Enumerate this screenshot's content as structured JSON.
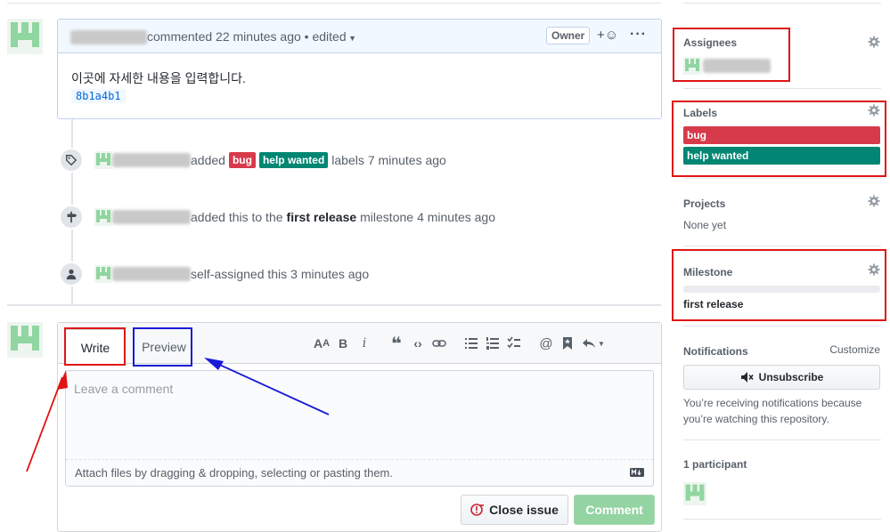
{
  "comment": {
    "action": "commented",
    "time": "22 minutes ago",
    "edited": "• edited",
    "owner_badge": "Owner",
    "body": "이곳에 자세한 내용을 입력합니다.",
    "sha": "8b1a4b1"
  },
  "timeline": {
    "labels_event": {
      "action": "added",
      "labels": [
        "bug",
        "help wanted"
      ],
      "suffix": "labels",
      "time": "7 minutes ago"
    },
    "milestone_event": {
      "action": "added this to the",
      "milestone": "first release",
      "suffix": "milestone",
      "time": "4 minutes ago"
    },
    "assign_event": {
      "action": "self-assigned this",
      "time": "3 minutes ago"
    }
  },
  "compose": {
    "tab_write": "Write",
    "tab_preview": "Preview",
    "placeholder": "Leave a comment",
    "attach_text": "Attach files by dragging & dropping, selecting or pasting them.",
    "close_issue": "Close issue",
    "comment_button": "Comment"
  },
  "sidebar": {
    "assignees_title": "Assignees",
    "labels_title": "Labels",
    "labels": [
      {
        "name": "bug",
        "color": "#d73a4a"
      },
      {
        "name": "help wanted",
        "color": "#008672"
      }
    ],
    "projects_title": "Projects",
    "projects_value": "None yet",
    "milestone_title": "Milestone",
    "milestone_value": "first release",
    "notifications_title": "Notifications",
    "customize": "Customize",
    "unsubscribe": "Unsubscribe",
    "notif_text": "You’re receiving notifications because you’re watching this repository.",
    "participants_title": "1 participant"
  },
  "colors": {
    "accent": "#0366d6",
    "annotation_red": "#e01515",
    "annotation_blue": "#1a1ad6",
    "comment_green": "#94d3a2"
  }
}
